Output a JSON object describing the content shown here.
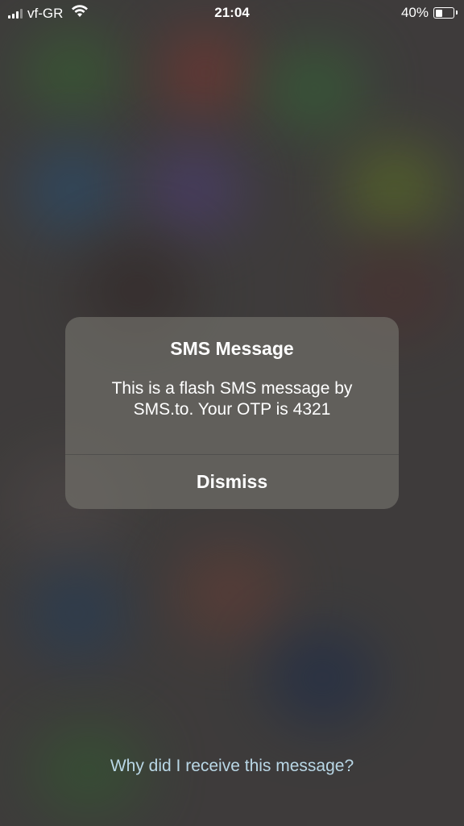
{
  "status_bar": {
    "carrier": "vf-GR",
    "time": "21:04",
    "battery_percent": "40%",
    "battery_level": 0.4,
    "signal_bars": 3,
    "signal_bars_total": 4,
    "icons": [
      "signal-icon",
      "wifi-icon",
      "battery-icon"
    ]
  },
  "alert": {
    "title": "SMS Message",
    "body": "This is a flash SMS message by SMS.to. Your OTP is 4321",
    "dismiss_label": "Dismiss"
  },
  "footer": {
    "link_text": "Why did I receive this message?"
  },
  "colors": {
    "link": "#b9d7e6",
    "text": "#ffffff"
  }
}
